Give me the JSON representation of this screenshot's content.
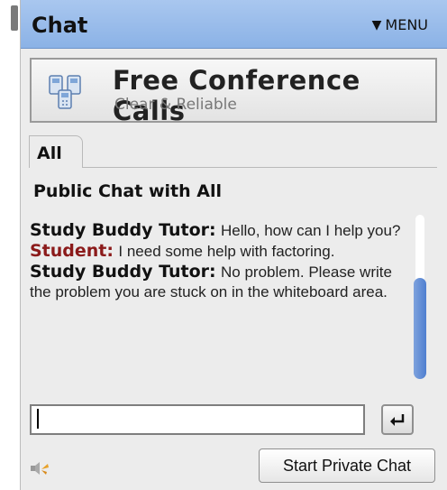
{
  "window": {
    "title": "Chat",
    "menu_label": "MENU",
    "menu_icon": "triangle-down-icon"
  },
  "ad": {
    "title": "Free Conference Calls",
    "subtitle": "Clear & Reliable",
    "icon": "phone-network-icon"
  },
  "tabs": [
    {
      "label": "All",
      "active": true
    }
  ],
  "chat": {
    "heading": "Public Chat with All",
    "messages": [
      {
        "sender": "Study Buddy Tutor:",
        "role": "tutor",
        "text": "Hello, how can I help you?"
      },
      {
        "sender": "Student:",
        "role": "student",
        "text": "I need some help with factoring."
      },
      {
        "sender": "Study Buddy Tutor:",
        "role": "tutor",
        "text": "No problem.  Please write the problem you are stuck on in the whiteboard area."
      }
    ]
  },
  "input": {
    "value": "",
    "placeholder": "",
    "send_icon": "enter-return-icon"
  },
  "footer": {
    "sound_icon": "speaker-icon",
    "private_chat_label": "Start Private Chat"
  },
  "colors": {
    "title_bar": "#8bb2e6",
    "student_name": "#8b1a1a",
    "scrollbar": "#4f7fd0"
  }
}
